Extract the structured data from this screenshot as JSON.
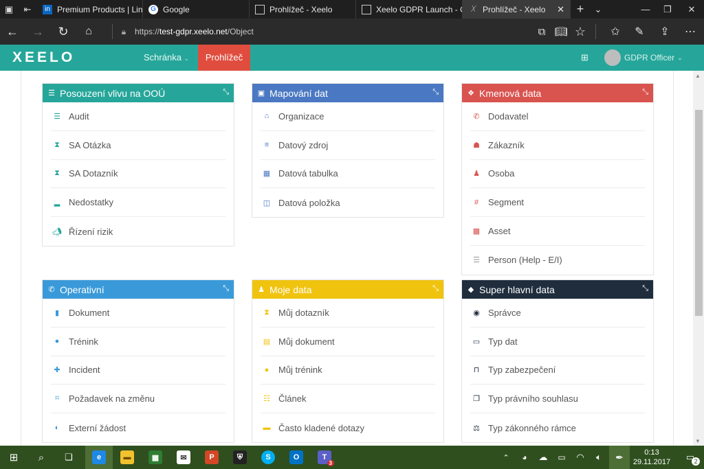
{
  "browser": {
    "tabs": [
      {
        "title": "",
        "icon": "tab-list-icon"
      },
      {
        "title": "",
        "icon": "set-aside-icon"
      },
      {
        "title": "Premium Products | Linke",
        "icon": "linkedin-icon"
      },
      {
        "title": "Google",
        "icon": "google-icon"
      },
      {
        "title": "Prohlížeč - Xeelo",
        "icon": "page-icon"
      },
      {
        "title": "Xeelo GDPR Launch - Or",
        "icon": "page-icon"
      },
      {
        "title": "Prohlížeč - Xeelo",
        "icon": "xeelo-icon",
        "active": true
      }
    ],
    "url_prefix": "https://",
    "url_host": "test-gdpr.xeelo.net",
    "url_path": "/Object"
  },
  "app": {
    "logo": "XEELO",
    "nav": {
      "clipboard": "Schránka",
      "browser": "Prohlížeč"
    },
    "user": "GDPR Officer",
    "accent": "#26a69a"
  },
  "panels": [
    {
      "title": "Posouzení vlivu na OOÚ",
      "color": "#26a69a",
      "icon": "list-icon",
      "items": [
        {
          "label": "Audit",
          "icon": "list-icon",
          "color": "#26a69a"
        },
        {
          "label": "SA Otázka",
          "icon": "hourglass-icon",
          "color": "#26a69a"
        },
        {
          "label": "SA Dotazník",
          "icon": "hourglass-icon",
          "color": "#26a69a"
        },
        {
          "label": "Nedostatky",
          "icon": "inbox-icon",
          "color": "#26a69a"
        },
        {
          "label": "Řízení rizik",
          "icon": "megaphone-icon",
          "color": "#26a69a"
        }
      ]
    },
    {
      "title": "Mapování dat",
      "color": "#4a78c2",
      "icon": "image-icon",
      "items": [
        {
          "label": "Organizace",
          "icon": "home-icon",
          "color": "#4a78c2"
        },
        {
          "label": "Datový zdroj",
          "icon": "database-icon",
          "color": "#4a78c2"
        },
        {
          "label": "Datová tabulka",
          "icon": "table-icon",
          "color": "#4a78c2"
        },
        {
          "label": "Datová položka",
          "icon": "columns-icon",
          "color": "#4a78c2"
        }
      ]
    },
    {
      "title": "Kmenová data",
      "color": "#d9534f",
      "icon": "cubes-icon",
      "items": [
        {
          "label": "Dodavatel",
          "icon": "wrench-icon",
          "color": "#d9534f"
        },
        {
          "label": "Zákazník",
          "icon": "users-icon",
          "color": "#d9534f"
        },
        {
          "label": "Osoba",
          "icon": "user-icon",
          "color": "#d9534f"
        },
        {
          "label": "Segment",
          "icon": "hashtag-icon",
          "color": "#d9534f"
        },
        {
          "label": "Asset",
          "icon": "qrcode-icon",
          "color": "#d9534f"
        },
        {
          "label": "Person (Help - E/I)",
          "icon": "list-icon",
          "color": "#9e9e9e"
        }
      ]
    },
    {
      "title": "Operativní",
      "color": "#3a9ad9",
      "icon": "wrench-icon",
      "items": [
        {
          "label": "Dokument",
          "icon": "file-icon",
          "color": "#3a9ad9"
        },
        {
          "label": "Trénink",
          "icon": "comment-icon",
          "color": "#3a9ad9"
        },
        {
          "label": "Incident",
          "icon": "medkit-icon",
          "color": "#3a9ad9"
        },
        {
          "label": "Požadavek na změnu",
          "icon": "crop-icon",
          "color": "#3a9ad9"
        },
        {
          "label": "Externí žádost",
          "icon": "volume-icon",
          "color": "#3a9ad9"
        }
      ]
    },
    {
      "title": "Moje data",
      "color": "#f0c30f",
      "icon": "user-icon",
      "items": [
        {
          "label": "Můj dotazník",
          "icon": "hourglass-icon",
          "color": "#f0c30f"
        },
        {
          "label": "Můj dokument",
          "icon": "file-text-icon",
          "color": "#f0c30f"
        },
        {
          "label": "Můj trénink",
          "icon": "comments-icon",
          "color": "#f0c30f"
        },
        {
          "label": "Článek",
          "icon": "list-ol-icon",
          "color": "#f0c30f"
        },
        {
          "label": "Často kladené dotazy",
          "icon": "book-icon",
          "color": "#f0c30f"
        }
      ]
    },
    {
      "title": "Super hlavní data",
      "color": "#1f2d3d",
      "icon": "cube-icon",
      "items": [
        {
          "label": "Správce",
          "icon": "user-circle-icon",
          "color": "#1f2d3d"
        },
        {
          "label": "Typ dat",
          "icon": "save-icon",
          "color": "#1f2d3d"
        },
        {
          "label": "Typ zabezpečení",
          "icon": "unlock-icon",
          "color": "#1f2d3d"
        },
        {
          "label": "Typ právního souhlasu",
          "icon": "clone-icon",
          "color": "#1f2d3d"
        },
        {
          "label": "Typ zákonného rámce",
          "icon": "balance-icon",
          "color": "#1f2d3d"
        }
      ]
    }
  ],
  "taskbar": {
    "time": "0:13",
    "date": "29.11.2017",
    "notifications": "2",
    "badge": "3"
  }
}
